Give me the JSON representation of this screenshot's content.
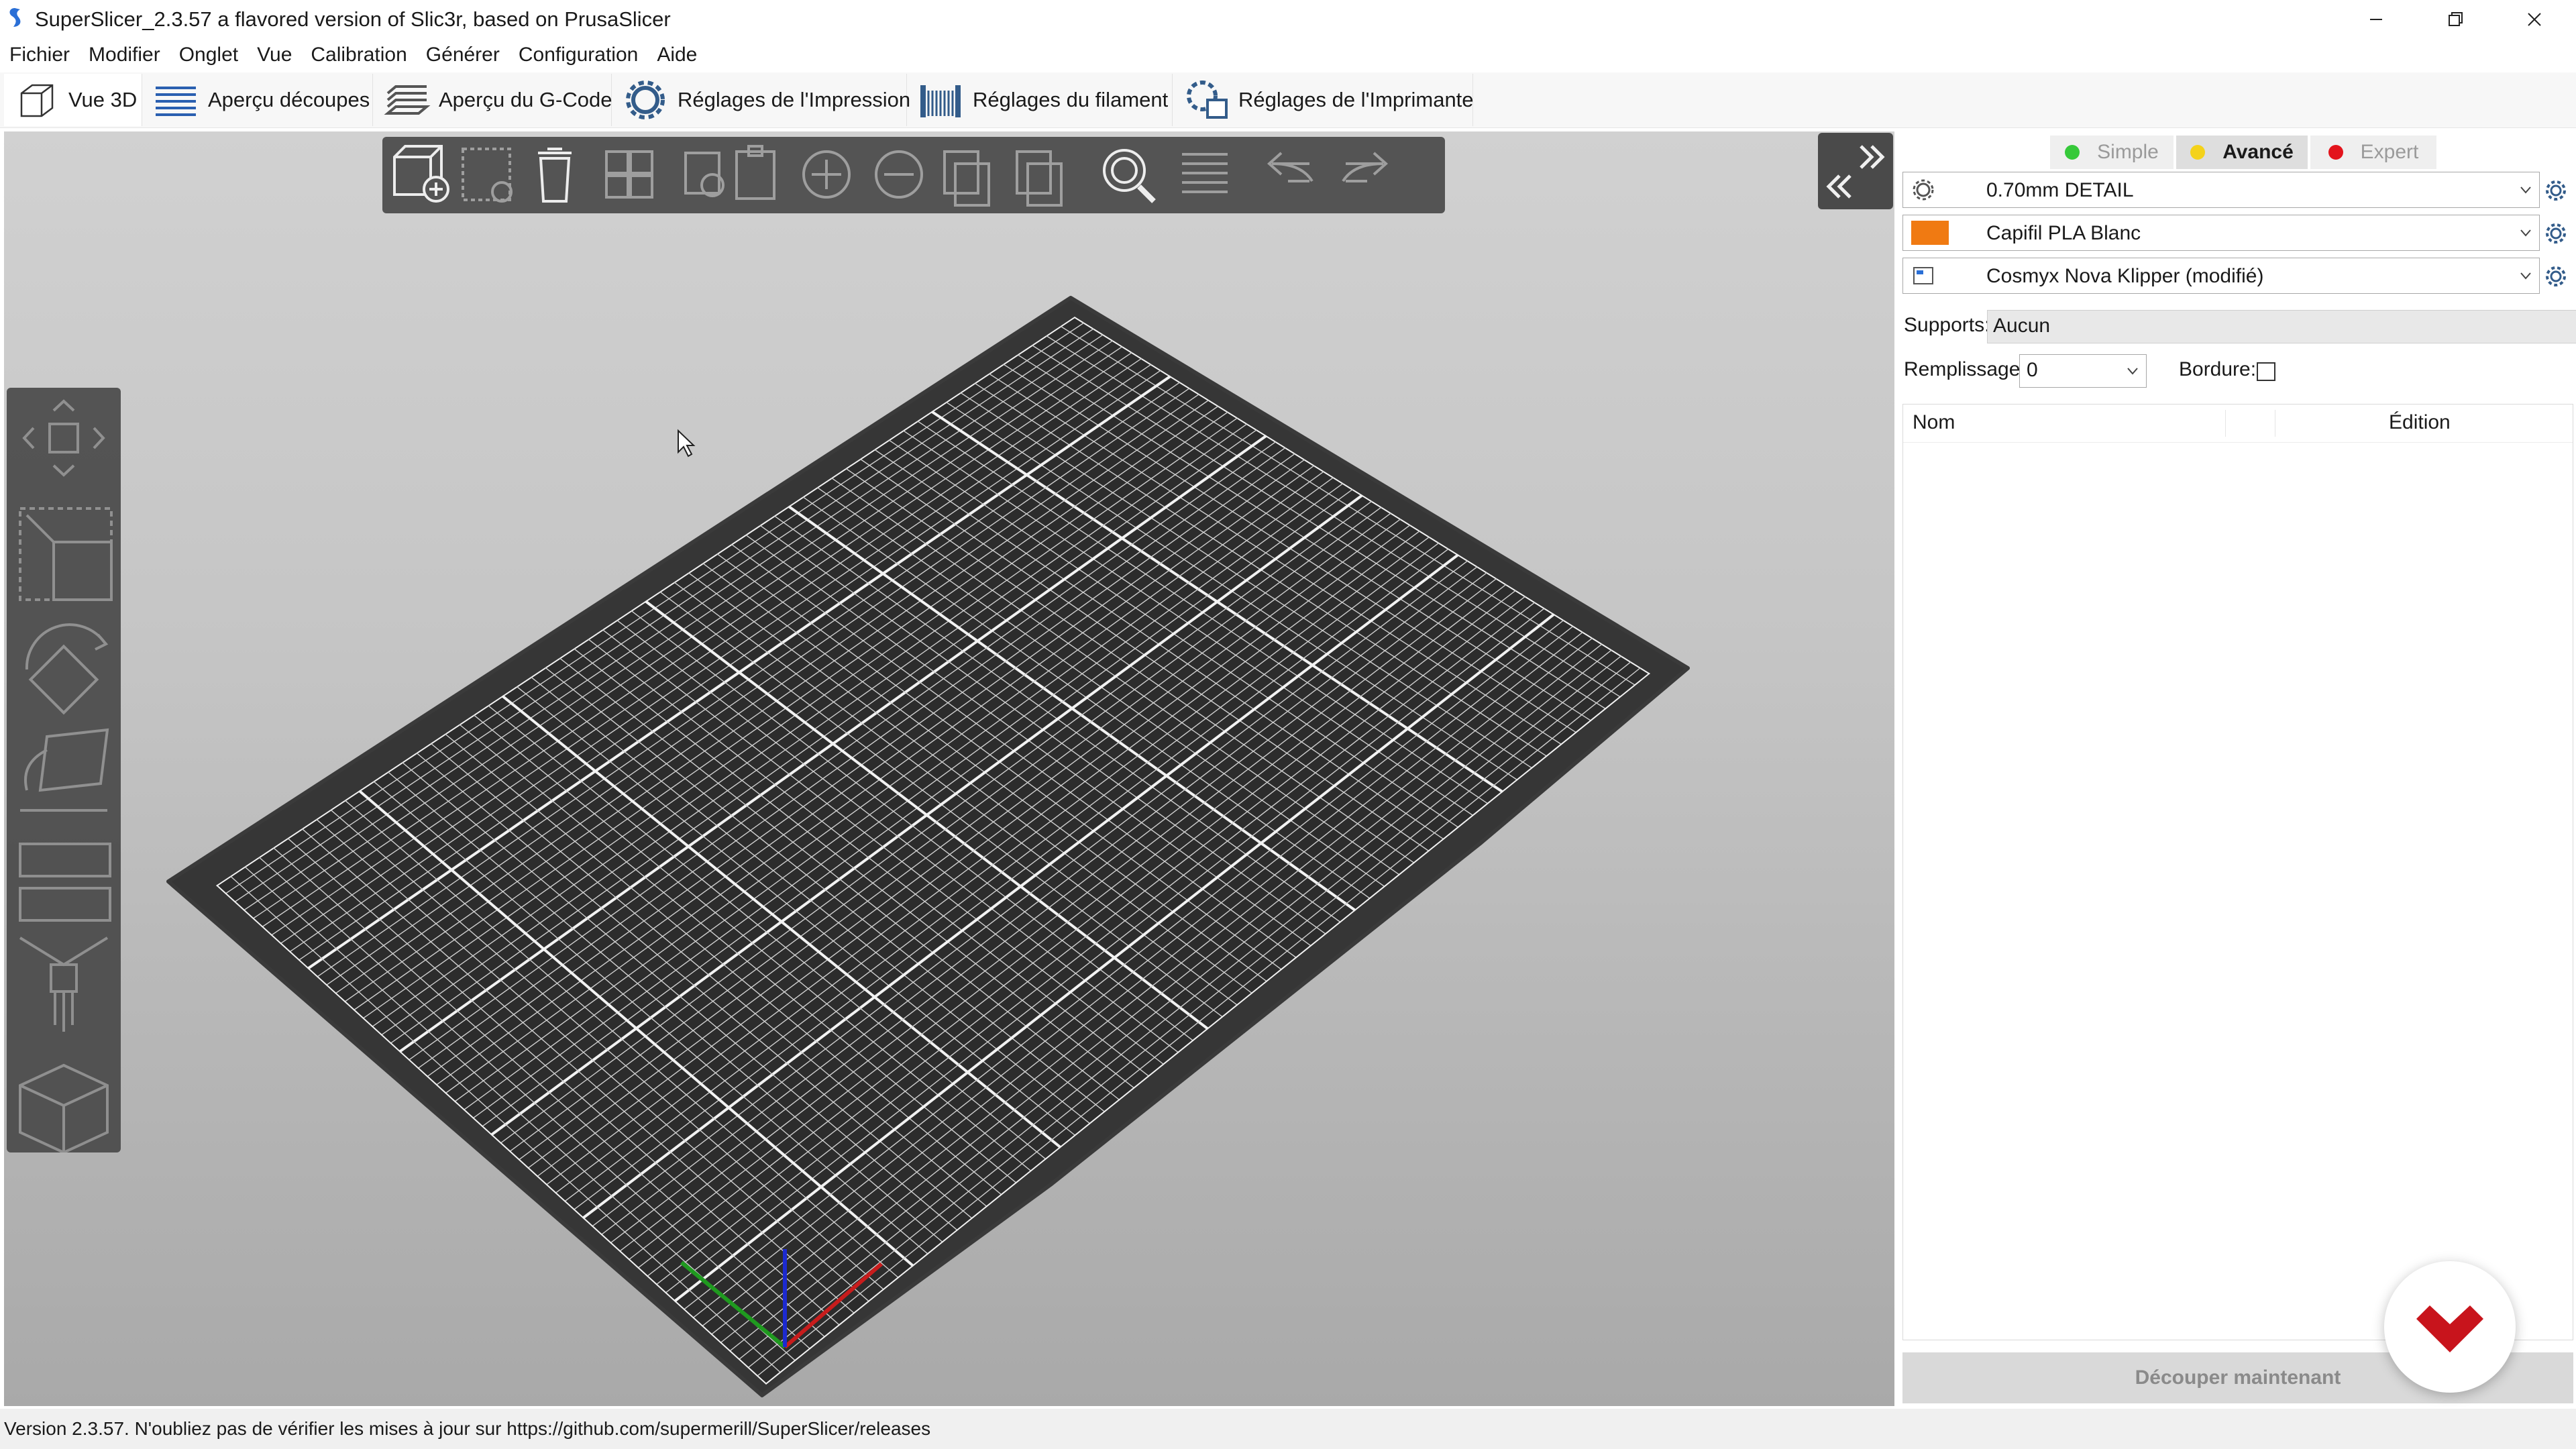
{
  "window": {
    "title": "SuperSlicer_2.3.57 a flavored version of Slic3r, based on PrusaSlicer",
    "controls": {
      "minimize": "—",
      "restore": "❐",
      "close": "✕"
    }
  },
  "menu": {
    "items": [
      {
        "label": "Fichier"
      },
      {
        "label": "Modifier"
      },
      {
        "label": "Onglet"
      },
      {
        "label": "Vue"
      },
      {
        "label": "Calibration"
      },
      {
        "label": "Générer"
      },
      {
        "label": "Configuration"
      },
      {
        "label": "Aide"
      }
    ]
  },
  "tabs": [
    {
      "label": "Vue 3D",
      "icon": "cube-icon",
      "active": true
    },
    {
      "label": "Aperçu découpes",
      "icon": "layers-icon"
    },
    {
      "label": "Aperçu du G-Code",
      "icon": "gcode-layers-icon"
    },
    {
      "label": "Réglages de l'Impression",
      "icon": "print-settings-gear-icon"
    },
    {
      "label": "Réglages du filament",
      "icon": "filament-spool-icon"
    },
    {
      "label": "Réglages de l'Imprimante",
      "icon": "printer-settings-icon"
    }
  ],
  "toolbar": {
    "icons": [
      "add-object-icon",
      "delete-selected-icon",
      "delete-all-icon",
      "arrange-icon",
      "copy-icon",
      "paste-icon",
      "add-instance-icon",
      "remove-instance-icon",
      "split-objects-icon",
      "split-parts-icon",
      "search-icon",
      "layer-editing-icon",
      "undo-icon",
      "redo-icon"
    ]
  },
  "left_toolbar": {
    "icons": [
      "move-icon",
      "scale-icon",
      "rotate-icon",
      "place-on-face-icon",
      "cut-icon",
      "paint-supports-icon",
      "seam-icon"
    ]
  },
  "modes": {
    "simple": {
      "label": "Simple",
      "color": "#36c93a"
    },
    "advanced": {
      "label": "Avancé",
      "color": "#f4d21a"
    },
    "expert": {
      "label": "Expert",
      "color": "#e3141c"
    }
  },
  "presets": {
    "print": {
      "value": "0.70mm DETAIL",
      "icon": "gear-icon"
    },
    "filament": {
      "value": "Capifil PLA Blanc",
      "color": "#f07a12"
    },
    "printer": {
      "value": "Cosmyx Nova Klipper (modifié)",
      "icon": "printer-icon"
    }
  },
  "settings": {
    "supports_label": "Supports:",
    "supports_value": "Aucun",
    "infill_label": "Remplissage:",
    "infill_value": "0",
    "brim_label": "Bordure:",
    "brim_checked": false
  },
  "object_list": {
    "columns": [
      "Nom",
      "Édition"
    ]
  },
  "actions": {
    "slice_now": "Découper maintenant"
  },
  "status": {
    "text": "Version 2.3.57. N'oubliez pas de vérifier les mises à jour sur https://github.com/supermerill/SuperSlicer/releases"
  }
}
